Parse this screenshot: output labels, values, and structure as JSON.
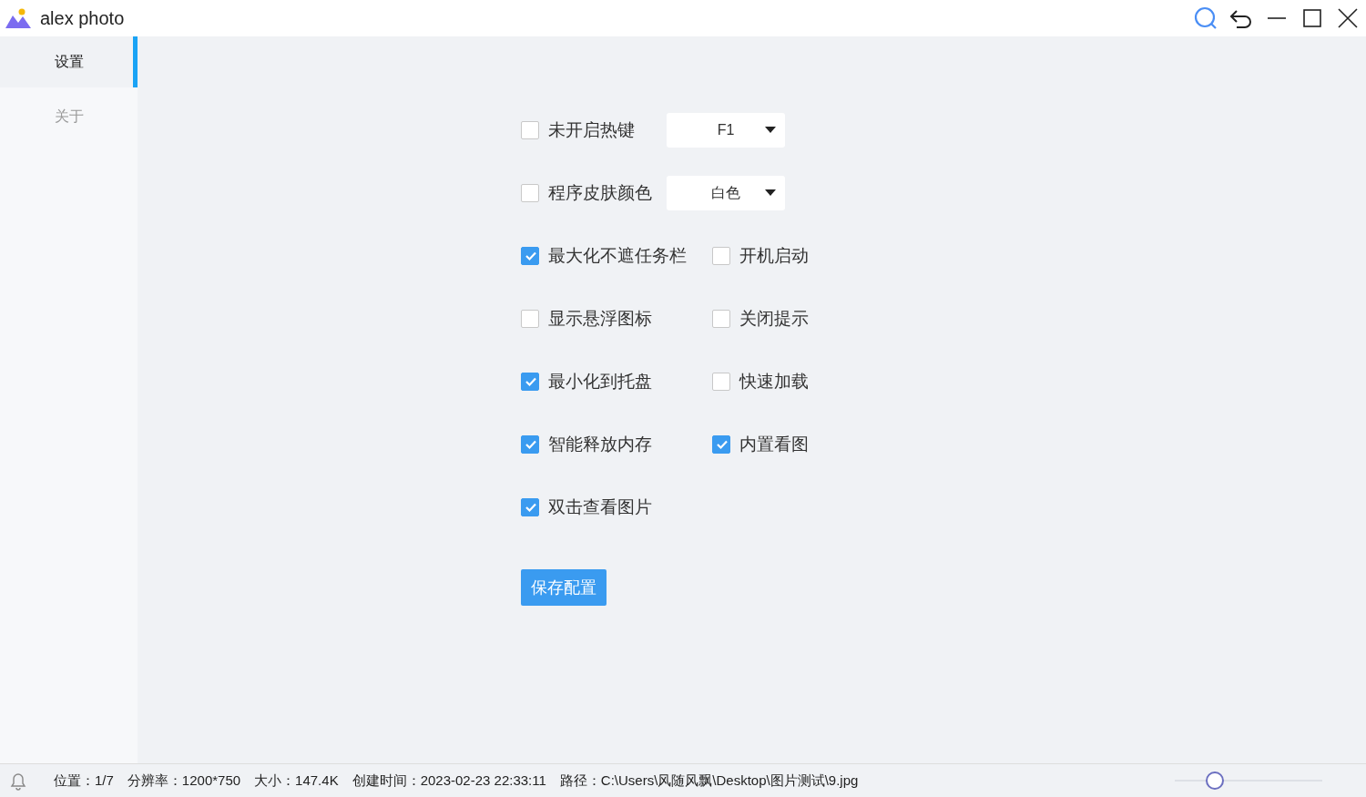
{
  "window": {
    "title": "alex photo"
  },
  "sidebar": {
    "items": [
      {
        "label": "设置",
        "selected": true
      },
      {
        "label": "关于",
        "selected": false
      }
    ]
  },
  "settings": {
    "rows": [
      {
        "items": [
          {
            "kind": "checkbox",
            "label": "未开启热键",
            "checked": false
          },
          {
            "kind": "dropdown",
            "value": "F1"
          }
        ]
      },
      {
        "items": [
          {
            "kind": "checkbox",
            "label": "程序皮肤颜色",
            "checked": false
          },
          {
            "kind": "dropdown",
            "value": "白色"
          }
        ]
      },
      {
        "items": [
          {
            "kind": "checkbox",
            "label": "最大化不遮任务栏",
            "checked": true
          },
          {
            "kind": "checkbox",
            "label": "开机启动",
            "checked": false
          }
        ]
      },
      {
        "items": [
          {
            "kind": "checkbox",
            "label": "显示悬浮图标",
            "checked": false
          },
          {
            "kind": "checkbox",
            "label": "关闭提示",
            "checked": false
          }
        ]
      },
      {
        "items": [
          {
            "kind": "checkbox",
            "label": "最小化到托盘",
            "checked": true
          },
          {
            "kind": "checkbox",
            "label": "快速加载",
            "checked": false
          }
        ]
      },
      {
        "items": [
          {
            "kind": "checkbox",
            "label": "智能释放内存",
            "checked": true
          },
          {
            "kind": "checkbox",
            "label": "内置看图",
            "checked": true
          }
        ]
      },
      {
        "items": [
          {
            "kind": "checkbox",
            "label": "双击查看图片",
            "checked": true
          }
        ]
      }
    ],
    "save_button": "保存配置"
  },
  "status_bar": {
    "fields": [
      "位置：1/7",
      "分辨率：1200*750",
      "大小：147.4K",
      "创建时间：2023-02-23 22:33:11",
      "路径：C:\\Users\\风随风飘\\Desktop\\图片测试\\9.jpg"
    ],
    "zoom_slider": {
      "level": 0.24
    }
  }
}
